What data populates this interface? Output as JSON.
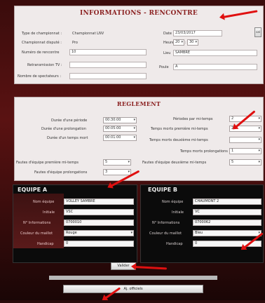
{
  "informations": {
    "title": "INFORMATIONS - RENCONTRE",
    "type_label": "Type de championnat :",
    "type_value": "Championnat LNV",
    "championnat_label": "Championnat disputé :",
    "championnat_value": "Pro",
    "numero_label": "Numéro de rencontre",
    "numero_value": "10",
    "retransmission_label": "Retransmission TV :",
    "retransmission_value": "",
    "spectateurs_label": "Nombre de spectateurs :",
    "spectateurs_value": "",
    "date_label": "Date",
    "date_value": "23/03/2017",
    "heure_label": "Heure",
    "heure_h": "20",
    "heure_m": "30",
    "lieu_label": "Lieu",
    "lieu_value": "SAMBRE",
    "poule_label": "Poule",
    "poule_value": "A",
    "calendar_label": "cal"
  },
  "reglement": {
    "title": "REGLEMENT",
    "left": [
      {
        "label": "Durée d'une période",
        "value": "00:30:00"
      },
      {
        "label": "Durée d'une prolongation",
        "value": "00:05:00"
      },
      {
        "label": "Durée d'un temps mort",
        "value": "00:01:00"
      }
    ],
    "right": [
      {
        "label": "Périodes par mi-temps",
        "value": "2"
      },
      {
        "label": "Temps morts première mi-temps",
        "value": "2"
      },
      {
        "label": "Temps morts deuxième mi-temps",
        "value": ""
      },
      {
        "label": "Temps morts prolongations",
        "value": "1"
      }
    ],
    "fautes_left_label": "Fautes d'équipe première mi-temps",
    "fautes_left_value": "5",
    "fautes_prol_label": "Fautes d'équipe prolongations",
    "fautes_prol_value": "3",
    "fautes_right_label": "Fautes d'équipe deuxième mi-temps",
    "fautes_right_value": "5"
  },
  "equipe_a": {
    "title": "EQUIPE A",
    "rows": [
      {
        "label": "Nom équipe",
        "value": "VOLLEY SAMBRE"
      },
      {
        "label": "Initiale",
        "value": "VSC"
      },
      {
        "label": "N° Informations",
        "value": "0700010"
      },
      {
        "label": "Couleur du maillot",
        "value": "Rouge"
      },
      {
        "label": "Handicap",
        "value": "0"
      }
    ]
  },
  "equipe_b": {
    "title": "EQUIPE B",
    "rows": [
      {
        "label": "Nom équipe",
        "value": "CHAUMONT 2"
      },
      {
        "label": "Initiale",
        "value": "VC"
      },
      {
        "label": "N° Informations",
        "value": "0700062"
      },
      {
        "label": "Couleur du maillot",
        "value": "Bleu"
      },
      {
        "label": "Handicap",
        "value": "0"
      }
    ]
  },
  "buttons": {
    "valider": "Valider",
    "officiels": "Aj. officiels"
  },
  "colors": {
    "accent": "#8a1f1f",
    "arrow": "#e01010"
  }
}
